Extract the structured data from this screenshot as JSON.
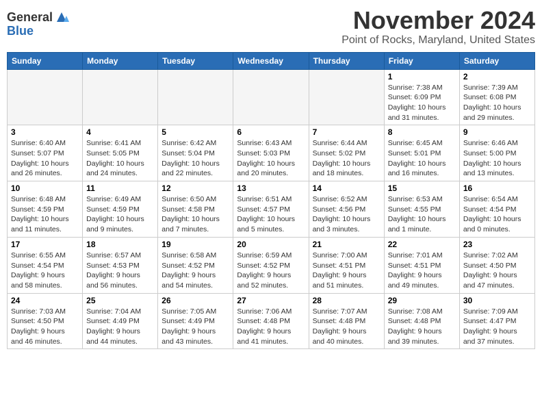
{
  "logo": {
    "general": "General",
    "blue": "Blue"
  },
  "title": "November 2024",
  "location": "Point of Rocks, Maryland, United States",
  "days_of_week": [
    "Sunday",
    "Monday",
    "Tuesday",
    "Wednesday",
    "Thursday",
    "Friday",
    "Saturday"
  ],
  "weeks": [
    [
      {
        "day": "",
        "empty": true
      },
      {
        "day": "",
        "empty": true
      },
      {
        "day": "",
        "empty": true
      },
      {
        "day": "",
        "empty": true
      },
      {
        "day": "",
        "empty": true
      },
      {
        "day": "1",
        "sunrise": "7:38 AM",
        "sunset": "6:09 PM",
        "daylight": "10 hours and 31 minutes."
      },
      {
        "day": "2",
        "sunrise": "7:39 AM",
        "sunset": "6:08 PM",
        "daylight": "10 hours and 29 minutes."
      }
    ],
    [
      {
        "day": "3",
        "sunrise": "6:40 AM",
        "sunset": "5:07 PM",
        "daylight": "10 hours and 26 minutes."
      },
      {
        "day": "4",
        "sunrise": "6:41 AM",
        "sunset": "5:05 PM",
        "daylight": "10 hours and 24 minutes."
      },
      {
        "day": "5",
        "sunrise": "6:42 AM",
        "sunset": "5:04 PM",
        "daylight": "10 hours and 22 minutes."
      },
      {
        "day": "6",
        "sunrise": "6:43 AM",
        "sunset": "5:03 PM",
        "daylight": "10 hours and 20 minutes."
      },
      {
        "day": "7",
        "sunrise": "6:44 AM",
        "sunset": "5:02 PM",
        "daylight": "10 hours and 18 minutes."
      },
      {
        "day": "8",
        "sunrise": "6:45 AM",
        "sunset": "5:01 PM",
        "daylight": "10 hours and 16 minutes."
      },
      {
        "day": "9",
        "sunrise": "6:46 AM",
        "sunset": "5:00 PM",
        "daylight": "10 hours and 13 minutes."
      }
    ],
    [
      {
        "day": "10",
        "sunrise": "6:48 AM",
        "sunset": "4:59 PM",
        "daylight": "10 hours and 11 minutes."
      },
      {
        "day": "11",
        "sunrise": "6:49 AM",
        "sunset": "4:59 PM",
        "daylight": "10 hours and 9 minutes."
      },
      {
        "day": "12",
        "sunrise": "6:50 AM",
        "sunset": "4:58 PM",
        "daylight": "10 hours and 7 minutes."
      },
      {
        "day": "13",
        "sunrise": "6:51 AM",
        "sunset": "4:57 PM",
        "daylight": "10 hours and 5 minutes."
      },
      {
        "day": "14",
        "sunrise": "6:52 AM",
        "sunset": "4:56 PM",
        "daylight": "10 hours and 3 minutes."
      },
      {
        "day": "15",
        "sunrise": "6:53 AM",
        "sunset": "4:55 PM",
        "daylight": "10 hours and 1 minute."
      },
      {
        "day": "16",
        "sunrise": "6:54 AM",
        "sunset": "4:54 PM",
        "daylight": "10 hours and 0 minutes."
      }
    ],
    [
      {
        "day": "17",
        "sunrise": "6:55 AM",
        "sunset": "4:54 PM",
        "daylight": "9 hours and 58 minutes."
      },
      {
        "day": "18",
        "sunrise": "6:57 AM",
        "sunset": "4:53 PM",
        "daylight": "9 hours and 56 minutes."
      },
      {
        "day": "19",
        "sunrise": "6:58 AM",
        "sunset": "4:52 PM",
        "daylight": "9 hours and 54 minutes."
      },
      {
        "day": "20",
        "sunrise": "6:59 AM",
        "sunset": "4:52 PM",
        "daylight": "9 hours and 52 minutes."
      },
      {
        "day": "21",
        "sunrise": "7:00 AM",
        "sunset": "4:51 PM",
        "daylight": "9 hours and 51 minutes."
      },
      {
        "day": "22",
        "sunrise": "7:01 AM",
        "sunset": "4:51 PM",
        "daylight": "9 hours and 49 minutes."
      },
      {
        "day": "23",
        "sunrise": "7:02 AM",
        "sunset": "4:50 PM",
        "daylight": "9 hours and 47 minutes."
      }
    ],
    [
      {
        "day": "24",
        "sunrise": "7:03 AM",
        "sunset": "4:50 PM",
        "daylight": "9 hours and 46 minutes."
      },
      {
        "day": "25",
        "sunrise": "7:04 AM",
        "sunset": "4:49 PM",
        "daylight": "9 hours and 44 minutes."
      },
      {
        "day": "26",
        "sunrise": "7:05 AM",
        "sunset": "4:49 PM",
        "daylight": "9 hours and 43 minutes."
      },
      {
        "day": "27",
        "sunrise": "7:06 AM",
        "sunset": "4:48 PM",
        "daylight": "9 hours and 41 minutes."
      },
      {
        "day": "28",
        "sunrise": "7:07 AM",
        "sunset": "4:48 PM",
        "daylight": "9 hours and 40 minutes."
      },
      {
        "day": "29",
        "sunrise": "7:08 AM",
        "sunset": "4:48 PM",
        "daylight": "9 hours and 39 minutes."
      },
      {
        "day": "30",
        "sunrise": "7:09 AM",
        "sunset": "4:47 PM",
        "daylight": "9 hours and 37 minutes."
      }
    ]
  ],
  "labels": {
    "sunrise": "Sunrise:",
    "sunset": "Sunset:",
    "daylight": "Daylight:"
  }
}
